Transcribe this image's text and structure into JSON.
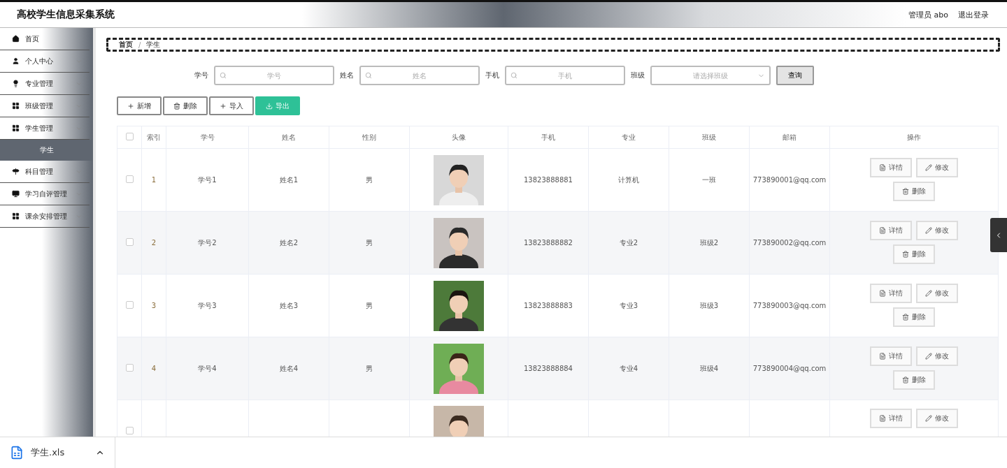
{
  "header": {
    "title": "高校学生信息采集系统",
    "user": "管理员 abo",
    "logout": "退出登录"
  },
  "sidebar": {
    "items": [
      {
        "label": "首页",
        "selected": false
      },
      {
        "label": "个人中心",
        "selected": false
      },
      {
        "label": "专业管理",
        "selected": false
      },
      {
        "label": "班级管理",
        "selected": false
      },
      {
        "label": "学生管理",
        "selected": false,
        "children": [
          {
            "label": "学生",
            "selected": true
          }
        ]
      },
      {
        "label": "科目管理",
        "selected": false
      },
      {
        "label": "学习自评管理",
        "selected": false
      },
      {
        "label": "课余安排管理",
        "selected": false
      }
    ]
  },
  "breadcrumb": {
    "items": [
      "首页",
      "学生"
    ],
    "separator": "/"
  },
  "search": {
    "fields": [
      {
        "label": "学号",
        "placeholder": "学号",
        "kind": "input"
      },
      {
        "label": "姓名",
        "placeholder": "姓名",
        "kind": "input"
      },
      {
        "label": "手机",
        "placeholder": "手机",
        "kind": "input"
      },
      {
        "label": "班级",
        "placeholder": "请选择班级",
        "kind": "select"
      }
    ],
    "button": "查询"
  },
  "toolbar": [
    {
      "label": "新增",
      "kind": "plain"
    },
    {
      "label": "删除",
      "kind": "plain"
    },
    {
      "label": "导入",
      "kind": "plain"
    },
    {
      "label": "导出",
      "kind": "primary"
    }
  ],
  "table": {
    "columns": [
      "索引",
      "学号",
      "姓名",
      "性别",
      "头像",
      "手机",
      "专业",
      "班级",
      "邮箱",
      "操作"
    ],
    "all_checked": false,
    "rows": [
      {
        "checked": false,
        "cells": [
          "1",
          "学号1",
          "姓名1",
          "男",
          "",
          "13823888881",
          "计算机",
          "一班",
          "773890001@qq.com"
        ],
        "actions": [
          "详情",
          "修改",
          "删除"
        ]
      },
      {
        "checked": false,
        "cells": [
          "2",
          "学号2",
          "姓名2",
          "男",
          "",
          "13823888882",
          "专业2",
          "班级2",
          "773890002@qq.com"
        ],
        "actions": [
          "详情",
          "修改",
          "删除"
        ]
      },
      {
        "checked": false,
        "cells": [
          "3",
          "学号3",
          "姓名3",
          "男",
          "",
          "13823888883",
          "专业3",
          "班级3",
          "773890003@qq.com"
        ],
        "actions": [
          "详情",
          "修改",
          "删除"
        ]
      },
      {
        "checked": false,
        "cells": [
          "4",
          "学号4",
          "姓名4",
          "男",
          "",
          "13823888884",
          "专业4",
          "班级4",
          "773890004@qq.com"
        ],
        "actions": [
          "详情",
          "修改",
          "删除"
        ]
      },
      {
        "checked": false,
        "kind": "partial",
        "actions": [
          "详情",
          "修改"
        ]
      }
    ]
  },
  "download_bar": {
    "file": "学生.xls"
  }
}
